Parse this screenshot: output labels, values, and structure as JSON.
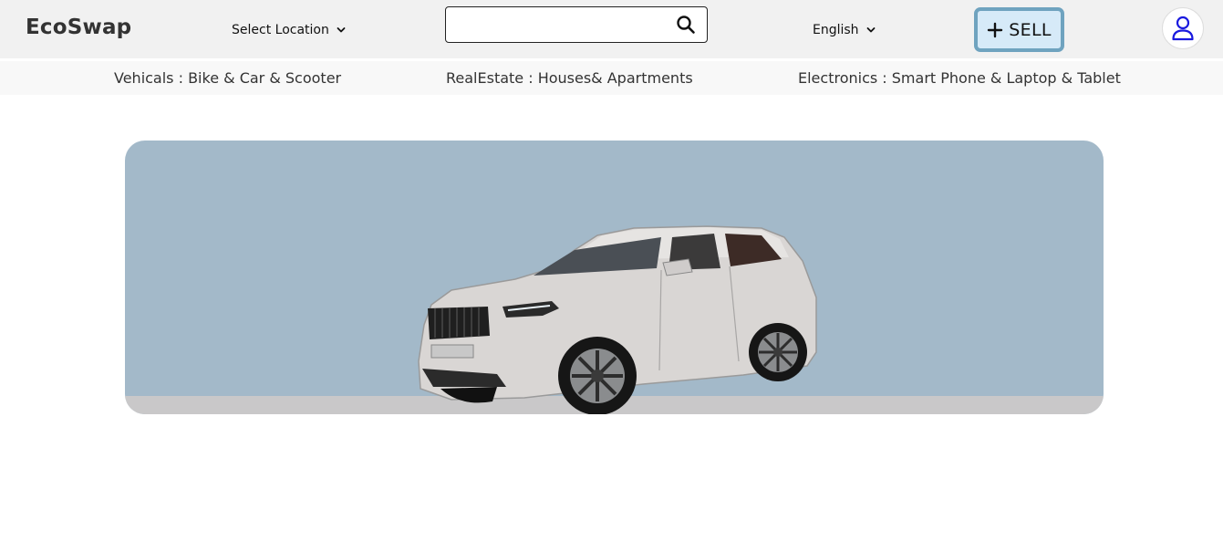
{
  "header": {
    "brand": "EcoSwap",
    "location_label": "Select Location",
    "search": {
      "value": "",
      "placeholder": ""
    },
    "language_label": "English",
    "sell_label": "SELL"
  },
  "categories": [
    "Vehicals : Bike & Car & Scooter",
    "RealEstate : Houses& Apartments",
    "Electronics : Smart Phone & Laptop & Tablet"
  ],
  "icons": {
    "location_dropdown": "chevron-down-icon",
    "search": "search-icon",
    "language_dropdown": "chevron-down-icon",
    "sell": "plus-icon",
    "profile": "user-icon"
  },
  "colors": {
    "topbar_bg": "#f1f1f1",
    "sell_bg": "#d6eaf8",
    "sell_border": "#6fa3bf",
    "profile_icon": "#1a1adf",
    "banner_bg": "#a3b9c9",
    "banner_floor": "#c9c8c9"
  }
}
